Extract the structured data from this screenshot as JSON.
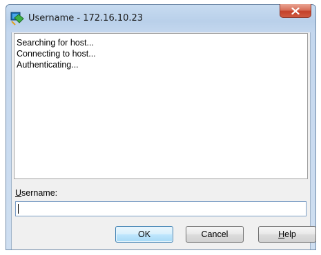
{
  "window": {
    "title": "Username - 172.16.10.23",
    "close_label": "Close"
  },
  "log": {
    "lines": [
      "Searching for host...",
      "Connecting to host...",
      "Authenticating..."
    ]
  },
  "form": {
    "username_label_mnemonic": "U",
    "username_label_rest": "sername:",
    "username_value": ""
  },
  "buttons": {
    "ok_label": "OK",
    "cancel_label": "Cancel",
    "help_mnemonic": "H",
    "help_rest": "elp"
  },
  "colors": {
    "titlebar": "#b9d0ea",
    "close_button": "#c4412a",
    "default_button_border": "#3c7fb1"
  },
  "icons": {
    "app": "terminal-connection-icon",
    "close": "close-x-icon"
  }
}
